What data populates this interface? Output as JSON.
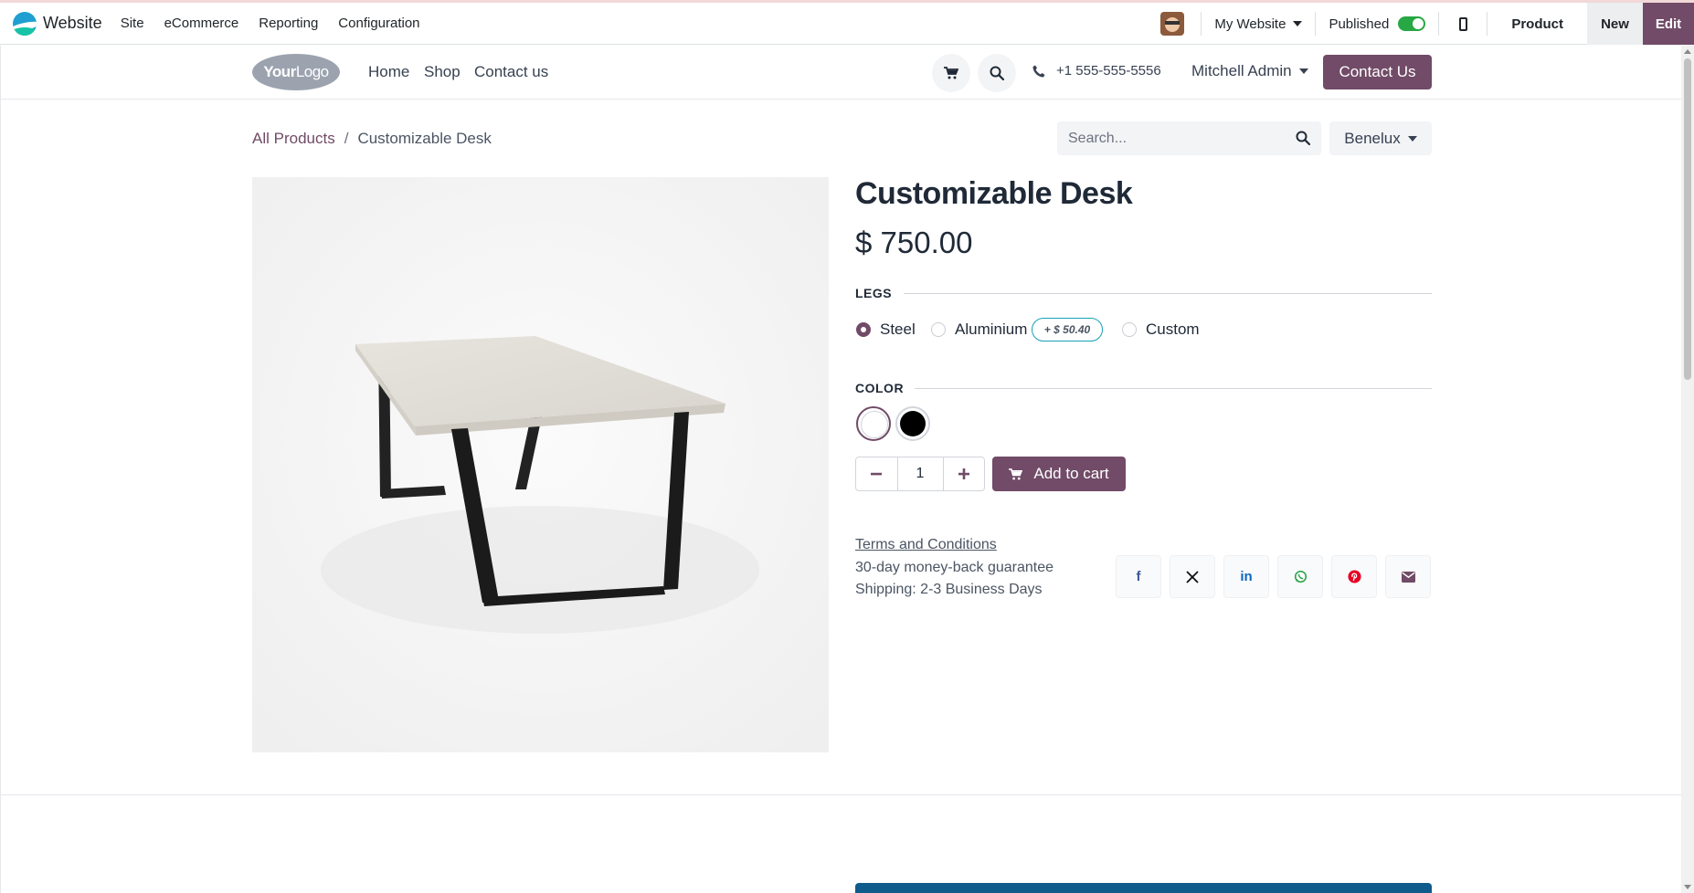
{
  "adminbar": {
    "app_name": "Website",
    "menu": [
      "Site",
      "eCommerce",
      "Reporting",
      "Configuration"
    ],
    "website_selector": "My Website",
    "published_label": "Published",
    "published": true,
    "product_label": "Product",
    "new_label": "New",
    "edit_label": "Edit"
  },
  "header": {
    "logo_bold": "Your",
    "logo_thin": "Logo",
    "nav": [
      "Home",
      "Shop",
      "Contact us"
    ],
    "phone": "+1 555-555-5556",
    "user": "Mitchell Admin",
    "contact_button": "Contact Us"
  },
  "breadcrumb": {
    "parent": "All Products",
    "separator": "/",
    "current": "Customizable Desk"
  },
  "search": {
    "placeholder": "Search..."
  },
  "pricelist": "Benelux",
  "product": {
    "name": "Customizable Desk",
    "price": "$ 750.00",
    "legs_label": "LEGS",
    "legs_options": [
      {
        "label": "Steel",
        "checked": true
      },
      {
        "label": "Aluminium",
        "checked": false,
        "extra": "+ $ 50.40"
      },
      {
        "label": "Custom",
        "checked": false
      }
    ],
    "color_label": "COLOR",
    "colors": [
      {
        "name": "White",
        "hex": "#ffffff",
        "selected": true
      },
      {
        "name": "Black",
        "hex": "#000000",
        "selected": false
      }
    ],
    "quantity": "1",
    "add_to_cart": "Add to cart",
    "terms": "Terms and Conditions",
    "guarantee": "30-day money-back guarantee",
    "shipping": "Shipping: 2-3 Business Days"
  },
  "share": [
    "facebook-icon",
    "x-icon",
    "linkedin-icon",
    "whatsapp-icon",
    "pinterest-icon",
    "email-icon"
  ],
  "colors": {
    "brand": "#714b67",
    "toggle_on": "#28a745",
    "badge_border": "#17a2b8",
    "facebook": "#3b5998",
    "linkedin": "#0a66c2",
    "whatsapp": "#25a244",
    "pinterest": "#e60023"
  }
}
